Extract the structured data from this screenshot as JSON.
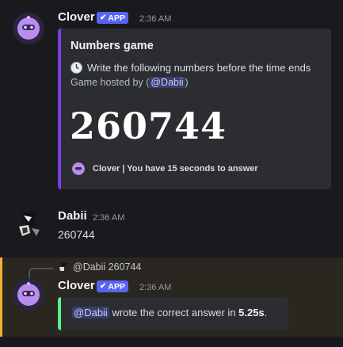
{
  "colors": {
    "background": "#1a1a1e",
    "embed_accent_purple": "#7b3fe4",
    "embed_accent_green": "#57f287",
    "app_badge": "#5865f2",
    "highlight_border": "#f0b232"
  },
  "messages": [
    {
      "author": "Clover",
      "badge": "APP",
      "time": "2:36 AM",
      "avatar_icon": "clover-bot-avatar",
      "embed": {
        "title": "Numbers game",
        "description_icon": "clock-icon",
        "description": "Write the following numbers before the time ends",
        "host_prefix": "Game hosted by (",
        "host_mention": "@Dabii",
        "host_suffix": ")",
        "number": "260744",
        "footer": "Clover | You have 15 seconds to answer"
      }
    },
    {
      "author": "Dabii",
      "time": "2:36 AM",
      "avatar_icon": "dabii-user-avatar",
      "content": "260744"
    },
    {
      "reply_to": {
        "mention": "@Dabii",
        "text": "260744"
      },
      "author": "Clover",
      "badge": "APP",
      "time": "2:36 AM",
      "avatar_icon": "clover-bot-avatar",
      "embed": {
        "mention": "@Dabii",
        "text_before": " wrote the correct answer in ",
        "emphasis": "5.25s",
        "text_after": "."
      }
    }
  ]
}
